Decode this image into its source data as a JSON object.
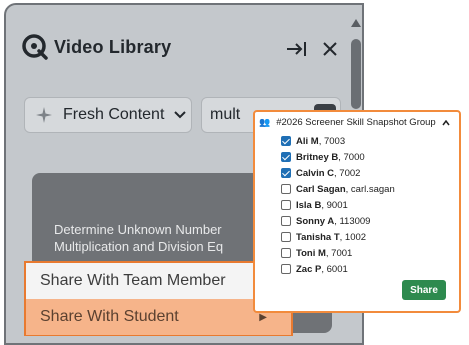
{
  "header": {
    "title": "Video Library",
    "expand_icon": "expand-right-icon",
    "close_icon": "close-icon"
  },
  "toolbar": {
    "filter_label": "Fresh Content",
    "search_value": "mult"
  },
  "card": {
    "line1": "Determine Unknown Number",
    "line2": "Multiplication and Division Eq"
  },
  "context_menu": {
    "items": [
      {
        "label": "Share With Team Member"
      },
      {
        "label": "Share With Student"
      }
    ]
  },
  "group_dropdown": {
    "title": "#2026 Screener Skill Snapshot Group",
    "students": [
      {
        "name": "Ali M",
        "id": ", 7003",
        "checked": true
      },
      {
        "name": "Britney B",
        "id": ", 7000",
        "checked": true
      },
      {
        "name": "Calvin C",
        "id": ", 7002",
        "checked": true
      },
      {
        "name": "Carl Sagan",
        "id": ", carl.sagan",
        "checked": false
      },
      {
        "name": "Isla B",
        "id": ", 9001",
        "checked": false
      },
      {
        "name": "Sonny A",
        "id": ", 113009",
        "checked": false
      },
      {
        "name": "Tanisha T",
        "id": ", 1002",
        "checked": false
      },
      {
        "name": "Toni M",
        "id": ", 7001",
        "checked": false
      },
      {
        "name": "Zac P",
        "id": ", 6001",
        "checked": false
      }
    ],
    "share_label": "Share"
  },
  "colors": {
    "accent_orange": "#f28b3c",
    "share_green": "#2d8a4e",
    "check_blue": "#1f6fb5"
  }
}
